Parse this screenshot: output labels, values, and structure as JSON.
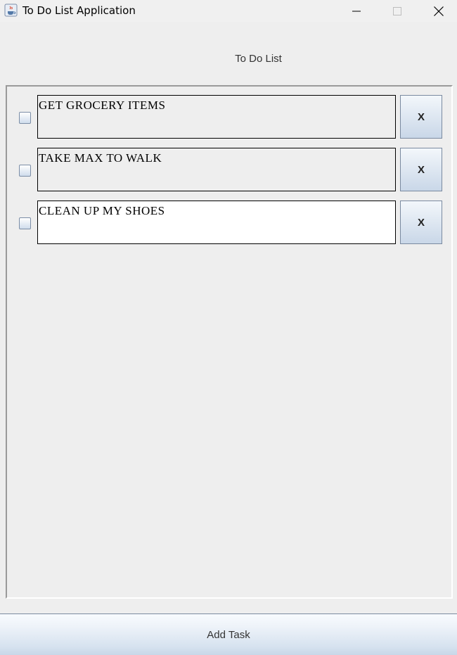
{
  "window": {
    "title": "To Do List Application",
    "icon": "java-cup-icon"
  },
  "header": {
    "label": "To Do List"
  },
  "tasks": [
    {
      "text": "GET GROCERY ITEMS",
      "checked": false,
      "delete_label": "X"
    },
    {
      "text": "TAKE MAX TO WALK",
      "checked": false,
      "delete_label": "X"
    },
    {
      "text": "CLEAN UP MY SHOES",
      "checked": false,
      "delete_label": "X"
    }
  ],
  "footer": {
    "add_label": "Add Task"
  },
  "colors": {
    "background": "#eeeeee",
    "button_gradient_top": "#f3f7fb",
    "button_gradient_bottom": "#c9d7e8",
    "border": "#7a8aa0"
  }
}
